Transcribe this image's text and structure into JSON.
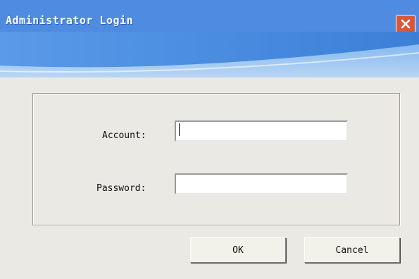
{
  "window": {
    "title": "Administrator Login",
    "close_icon": "close-icon",
    "accent_color": "#4f8be0",
    "close_color": "#d8573a"
  },
  "form": {
    "account_label": "Account:",
    "account_value": "",
    "password_label": "Password:",
    "password_value": ""
  },
  "buttons": {
    "ok_label": "OK",
    "cancel_label": "Cancel"
  }
}
